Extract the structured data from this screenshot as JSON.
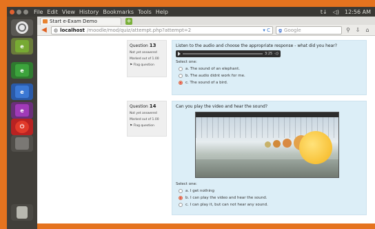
{
  "panel": {
    "menus": [
      "File",
      "Edit",
      "View",
      "History",
      "Bookmarks",
      "Tools",
      "Help"
    ],
    "tray": [
      "t↓",
      "◁)",
      "12:56 AM"
    ]
  },
  "browser": {
    "tab_title": "Start e-Exam Demo",
    "url_host": "localhost",
    "url_path": "/moodle/mod/quiz/attempt.php?attempt=2",
    "search_placeholder": "Google"
  },
  "q13": {
    "label": "Question",
    "number": "13",
    "status": "Not yet answered",
    "marks": "Marked out of 1.00",
    "flag": "Flag question",
    "text": "Listen to the audio and choose the appropriate response - what did you hear?",
    "audio_time": "3:25",
    "select_one": "Select one:",
    "options": [
      "a. The sound of an elephant.",
      "b. The audio didnt work for me.",
      "c. The sound of a bird."
    ],
    "selected": 2
  },
  "q14": {
    "label": "Question",
    "number": "14",
    "status": "Not yet answered",
    "marks": "Marked out of 1.00",
    "flag": "Flag question",
    "text": "Can you play the video and hear the sound?",
    "select_one": "Select one:",
    "options": [
      "a. I get nothing",
      "b. I can play the video and hear the sound.",
      "c. I can play it, but can not hear any sound."
    ],
    "selected": 1
  },
  "colors": {
    "desktop_frame": "#e5731f",
    "launcher_bg": "#413f3a",
    "question_bg": "#dceef7",
    "info_bg": "#efefef"
  }
}
